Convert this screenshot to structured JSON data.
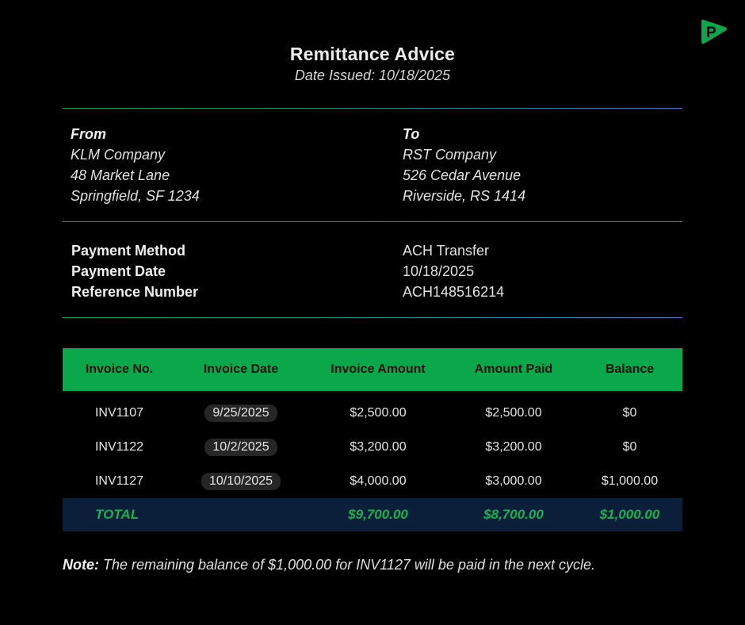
{
  "brand": {
    "logo_icon": "p-brand-icon",
    "accent": "#0aa84a"
  },
  "header": {
    "title": "Remittance Advice",
    "subtitle": "Date Issued: 10/18/2025"
  },
  "from": {
    "label": "From",
    "name": "KLM Company",
    "street": "48 Market Lane",
    "city": "Springfield, SF 1234"
  },
  "to": {
    "label": "To",
    "name": "RST Company",
    "street": "526 Cedar Avenue",
    "city": "Riverside, RS 1414"
  },
  "payment": {
    "method_label": "Payment Method",
    "method_value": "ACH Transfer",
    "date_label": "Payment Date",
    "date_value": "10/18/2025",
    "ref_label": "Reference Number",
    "ref_value": "ACH148516214"
  },
  "table": {
    "columns": [
      "Invoice No.",
      "Invoice Date",
      "Invoice Amount",
      "Amount Paid",
      "Balance"
    ],
    "rows": [
      [
        "INV1107",
        "9/25/2025",
        "$2,500.00",
        "$2,500.00",
        "$0"
      ],
      [
        "INV1122",
        "10/2/2025",
        "$3,200.00",
        "$3,200.00",
        "$0"
      ],
      [
        "INV1127",
        "10/10/2025",
        "$4,000.00",
        "$3,000.00",
        "$1,000.00"
      ]
    ],
    "total": {
      "label": "TOTAL",
      "invoice_amount": "$9,700.00",
      "amount_paid": "$8,700.00",
      "balance": "$1,000.00"
    }
  },
  "note": {
    "label": "Note:",
    "text": " The remaining balance of $1,000.00 for INV1127 will be paid in the next cycle."
  }
}
